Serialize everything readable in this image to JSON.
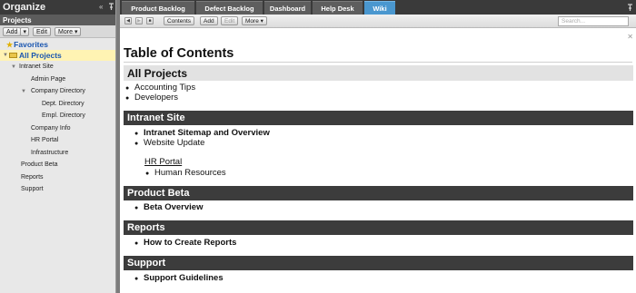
{
  "sidebar": {
    "title": "Organize",
    "projects_label": "Projects",
    "toolbar": {
      "add": "Add",
      "add_arrow": "▾",
      "edit": "Edit",
      "more": "More ▾"
    },
    "tree": {
      "favorites": "Favorites",
      "all_projects": "All Projects",
      "items": [
        {
          "label": "Intranet Site"
        },
        {
          "label": "Admin Page"
        },
        {
          "label": "Company Directory"
        },
        {
          "label": "Dept. Directory"
        },
        {
          "label": "Empl. Directory"
        },
        {
          "label": "Company Info"
        },
        {
          "label": "HR Portal"
        },
        {
          "label": "Infrastructure"
        },
        {
          "label": "Product Beta"
        },
        {
          "label": "Reports"
        },
        {
          "label": "Support"
        }
      ]
    },
    "collapse_icon": "«",
    "pin_icon": "pin-icon"
  },
  "tabs": [
    {
      "label": "Product Backlog"
    },
    {
      "label": "Defect Backlog"
    },
    {
      "label": "Dashboard"
    },
    {
      "label": "Help Desk"
    },
    {
      "label": "Wiki"
    }
  ],
  "toolbar": {
    "contents": "Contents",
    "add": "Add",
    "edit": "Edit",
    "more": "More ▾",
    "search_placeholder": "Search..."
  },
  "content": {
    "title": "Table of Contents",
    "sections": [
      {
        "title": "All Projects",
        "items": [
          "Accounting Tips",
          "Developers"
        ]
      },
      {
        "title": "Intranet Site",
        "items": [
          "Intranet Sitemap and Overview",
          "Website Update"
        ],
        "sub": {
          "title": "HR Portal",
          "items": [
            "Human Resources"
          ]
        }
      },
      {
        "title": "Product Beta",
        "items": [
          "Beta Overview"
        ]
      },
      {
        "title": "Reports",
        "items": [
          "How to Create Reports"
        ]
      },
      {
        "title": "Support",
        "items": [
          "Support Guidelines"
        ]
      }
    ]
  },
  "colors": {
    "active_tab": "#4a97cf",
    "section_header": "#3c3c3c",
    "selected_node": "#fff3b3"
  }
}
